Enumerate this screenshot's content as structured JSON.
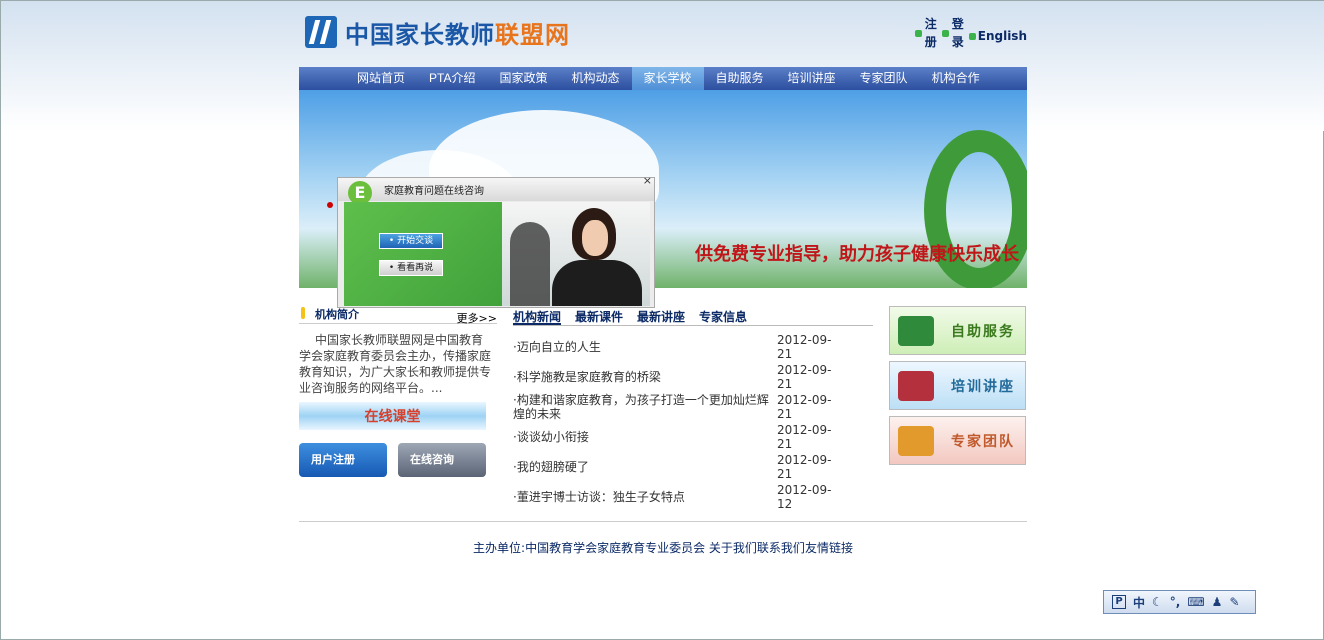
{
  "site": {
    "title_main": "中国家长教师",
    "title_highlight": "联盟网"
  },
  "toplinks": {
    "register": [
      "注",
      "册"
    ],
    "login": [
      "登",
      "录"
    ],
    "english": "English"
  },
  "nav": {
    "items": [
      "网站首页",
      "PTA介绍",
      "国家政策",
      "机构动态",
      "家长学校",
      "自助服务",
      "培训讲座",
      "专家团队",
      "机构合作"
    ],
    "active": "家长学校"
  },
  "banner": {
    "slogan": "供免费专业指导，助力孩子健康快乐成长"
  },
  "popup": {
    "title": "家庭教育问题在线咨询",
    "logo_letter": "E",
    "close": "×",
    "start_button": "• 开始交谈",
    "later_button": "• 看看再说"
  },
  "left": {
    "section_title": "机构简介",
    "more": "更多>>",
    "intro": "中国家长教师联盟网是中国教育学会家庭教育委员会主办，传播家庭教育知识，为广大家长和教师提供专业咨询服务的网络平台。...",
    "online_class": "在线课堂",
    "user_register": "用户注册",
    "online_consult": "在线咨询"
  },
  "tabs": [
    "机构新闻",
    "最新课件",
    "最新讲座",
    "专家信息"
  ],
  "news": [
    {
      "title": "·迈向自立的人生",
      "date_line1": "2012-09-",
      "date_line2": "21"
    },
    {
      "title": "·科学施教是家庭教育的桥梁",
      "date_line1": "2012-09-",
      "date_line2": "21"
    },
    {
      "title": "·构建和谐家庭教育，为孩子打造一个更加灿烂辉煌的未来",
      "date_line1": "2012-09-",
      "date_line2": "21"
    },
    {
      "title": "·谈谈幼小衔接",
      "date_line1": "2012-09-",
      "date_line2": "21"
    },
    {
      "title": "·我的翅膀硬了",
      "date_line1": "2012-09-",
      "date_line2": "21"
    },
    {
      "title": "·董进宇博士访谈：独生子女特点",
      "date_line1": "2012-09-",
      "date_line2": "12"
    }
  ],
  "right_buttons": [
    "自助服务",
    "培训讲座",
    "专家团队"
  ],
  "footer": {
    "sponsor": "主办单位:中国教育学会家庭教育专业委员会",
    "about": "关于我们",
    "contact": "联系我们",
    "links": "友情链接"
  },
  "ime": {
    "mode": "中",
    "glyphs": [
      "P",
      "☾",
      "°,",
      "⌨",
      "♟",
      "✎"
    ]
  }
}
